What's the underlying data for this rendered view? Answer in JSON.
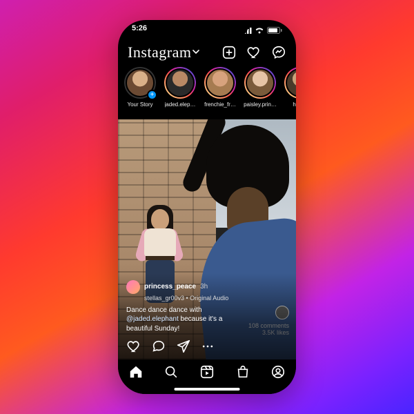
{
  "status": {
    "time": "5:26"
  },
  "header": {
    "logo": "Instagram"
  },
  "stories": [
    {
      "label": "Your Story",
      "ring": false,
      "add": true
    },
    {
      "label": "jaded.elep…",
      "ring": true,
      "add": false
    },
    {
      "label": "frenchie_fr…",
      "ring": true,
      "add": false
    },
    {
      "label": "paisley.prin…",
      "ring": true,
      "add": false
    },
    {
      "label": "hea…",
      "ring": true,
      "add": false
    }
  ],
  "post": {
    "username": "princess_peace",
    "age": "3h",
    "subline": "stellas_gr00v3 • Original Audio",
    "caption_pre": "Dance dance dance with ",
    "mention": "@jaded.elephant",
    "caption_post": " because it's a beautiful Sunday!",
    "comments": "108 comments",
    "likes": "3.5K likes"
  }
}
